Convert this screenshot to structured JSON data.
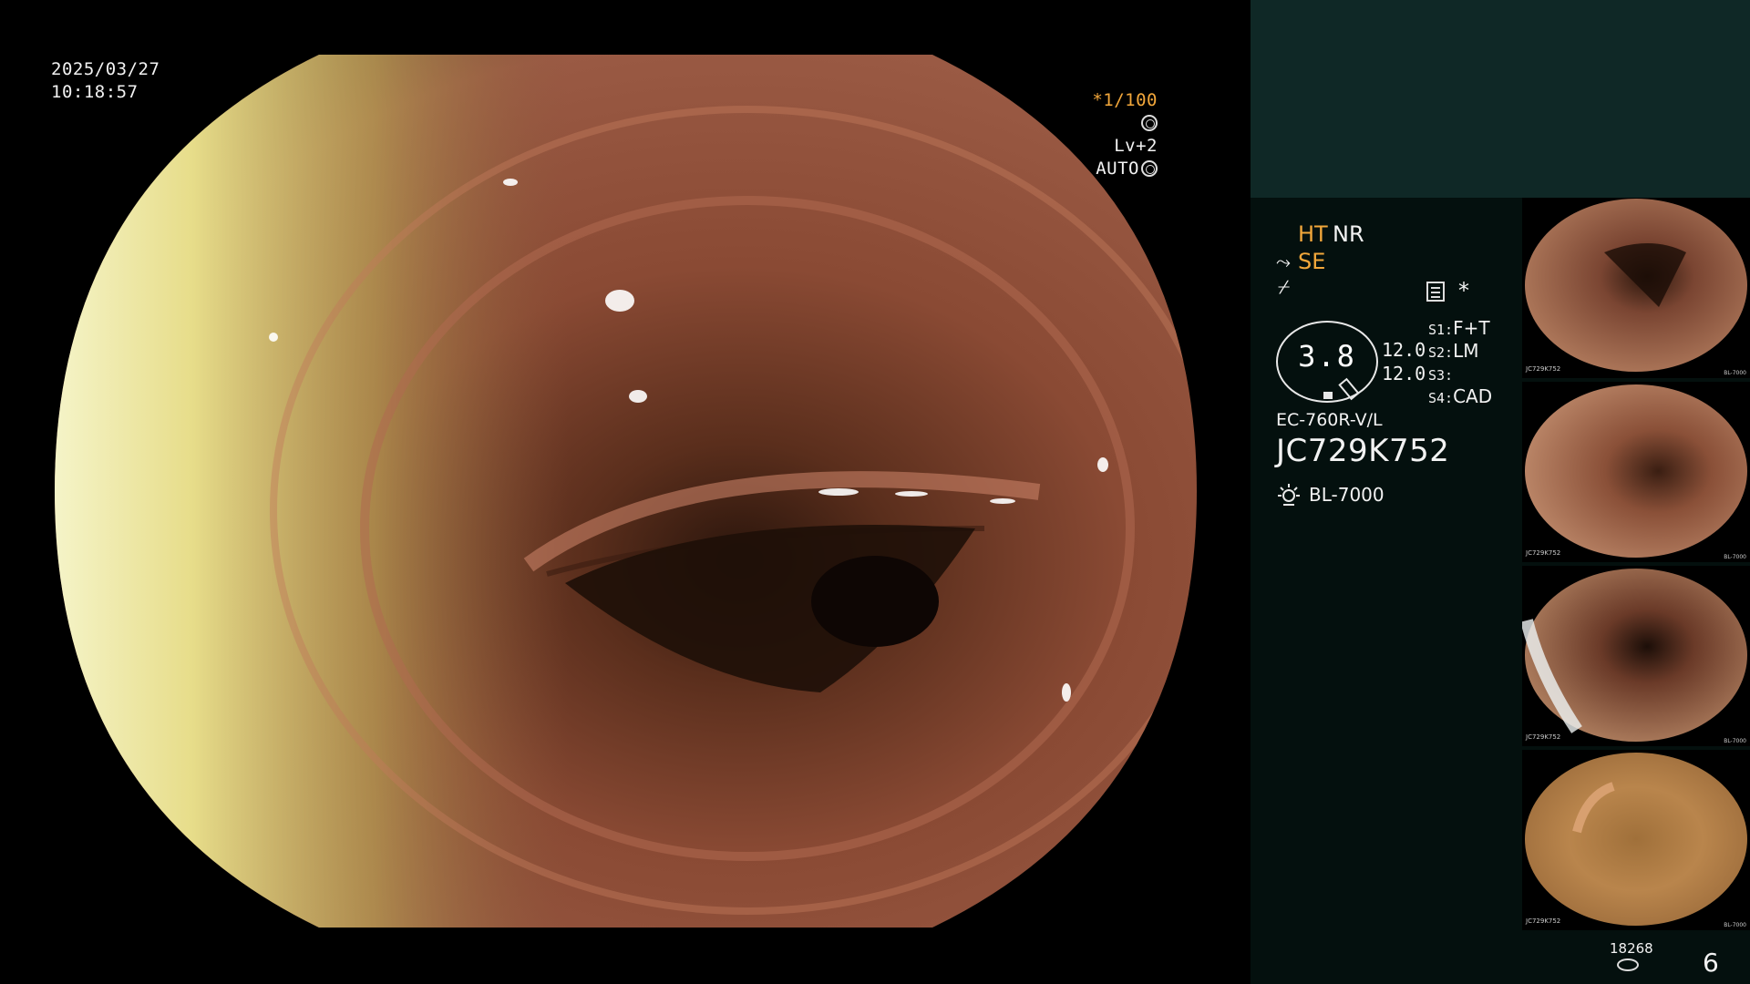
{
  "osd": {
    "date": "2025/03/27",
    "time": "10:18:57",
    "shutter": "*1/100",
    "level": "Lv+2 AUTO"
  },
  "panel": {
    "mode_ht": "HT",
    "mode_nr": "NR",
    "mode_se": "SE",
    "star": "*",
    "gauge_value": "3.8",
    "value_1": "12.0",
    "value_2": "12.0",
    "switches": [
      {
        "label": "S1:",
        "value": "F+T"
      },
      {
        "label": "S2:",
        "value": "LM"
      },
      {
        "label": "S3:",
        "value": ""
      },
      {
        "label": "S4:",
        "value": "CAD"
      }
    ],
    "scope_model": "EC-760R-V/L",
    "scope_serial": "JC729K752",
    "light_source": "BL-7000"
  },
  "thumbnails": [
    {
      "serial": "JC729K752",
      "source": "BL-7000"
    },
    {
      "serial": "JC729K752",
      "source": "BL-7000"
    },
    {
      "serial": "JC729K752",
      "source": "BL-7000"
    },
    {
      "serial": "JC729K752",
      "source": "BL-7000"
    }
  ],
  "footer": {
    "image_count": "18268",
    "capture_number": "6"
  },
  "colors": {
    "accent_orange": "#f2a73b",
    "panel_top": "#0f2826",
    "panel_bg": "#04100e"
  }
}
